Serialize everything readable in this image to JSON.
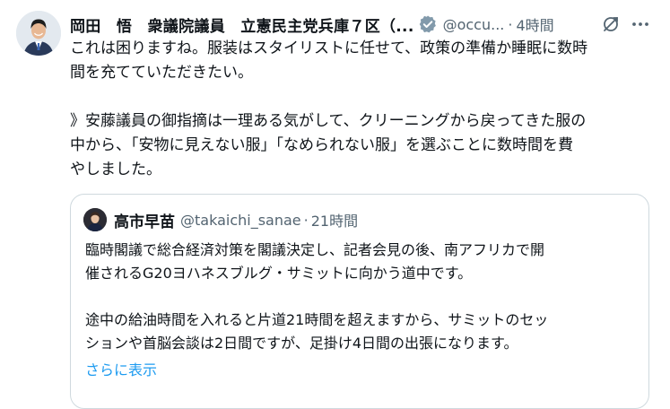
{
  "tweet": {
    "author_name": "岡田　悟　衆議院議員　立憲民主党兵庫７区（...",
    "handle": "@occu...",
    "separator": "·",
    "time": "4時間",
    "icons": {
      "verified": "verified-badge-icon",
      "grok": "grok-icon",
      "more": "more-icon"
    },
    "body": [
      "これは困りますね。服装はスタイリストに任せて、政策の準備か睡眠に数時",
      "間を充てていただきたい。",
      "",
      "》安藤議員の御指摘は一理ある気がして、クリーニングから戻ってきた服の",
      "中から、「安物に見えない服」「なめられない服」を選ぶことに数時間を費",
      "やしました。"
    ]
  },
  "quote": {
    "author_name": "高市早苗",
    "handle": "@takaichi_sanae",
    "separator": "·",
    "time": "21時間",
    "body": [
      "臨時閣議で総合経済対策を閣議決定し、記者会見の後、南アフリカで開",
      "催されるG20ヨハネスブルグ・サミットに向かう道中です。",
      "",
      "途中の給油時間を入れると片道21時間を超えますから、サミットのセッ",
      "ションや首脳会談は2日間ですが、足掛け4日間の出張になります。"
    ],
    "show_more": "さらに表示"
  },
  "colors": {
    "text": "#0f1419",
    "secondary": "#536471",
    "accent": "#1d9bf0",
    "border": "#cfd9de"
  }
}
